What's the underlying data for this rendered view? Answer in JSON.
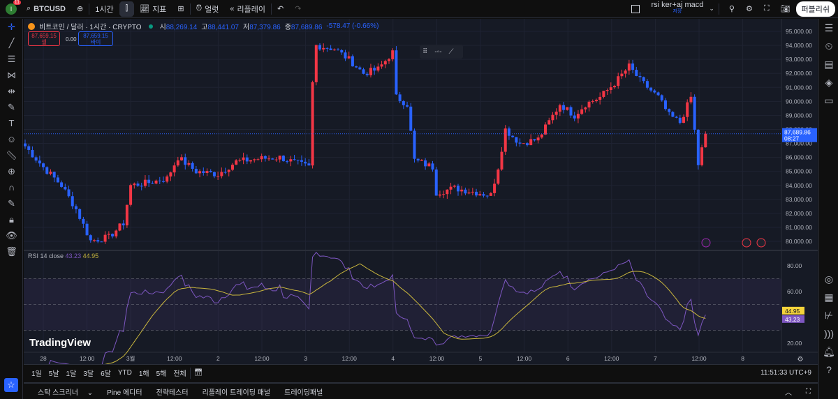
{
  "topbar": {
    "avatar_initial": "I",
    "notifications": "11",
    "symbol": "BTCUSD",
    "interval": "1시간",
    "indicators": "지표",
    "alert": "얼럿",
    "replay": "리플레이",
    "layout_name": "rsi ker+aj macd",
    "layout_status": "저장",
    "publish": "퍼블리쉬"
  },
  "legend": {
    "title": "비트코인 / 달러 · 1시간 · CRYPTO",
    "open_label": "시",
    "open": "88,269.14",
    "high_label": "고",
    "high": "88,441.07",
    "low_label": "저",
    "low": "87,379.86",
    "close_label": "종",
    "close": "87,689.86",
    "change": "-578.47 (-0.66%)",
    "sell_price": "87,659.15",
    "sell_label": "셀",
    "spread": "0.00",
    "buy_price": "87,659.15",
    "buy_label": "바이"
  },
  "colors": {
    "up": "#f23645",
    "down": "#2962ff",
    "rsi": "#7e57c2",
    "rsi_ma": "#c9b63d",
    "bg": "#161a25"
  },
  "price_axis": {
    "labels": [
      "95,000.00",
      "94,000.00",
      "93,000.00",
      "92,000.00",
      "91,000.00",
      "90,000.00",
      "89,000.00",
      "88,000.00",
      "87,000.00",
      "86,000.00",
      "85,000.00",
      "84,000.00",
      "83,000.00",
      "82,000.00",
      "81,000.00",
      "80,000.00"
    ],
    "last_price": "87,689.86",
    "countdown": "08:27"
  },
  "rsi_pane": {
    "title": "RSI 14 close",
    "rsi_value": "43.23",
    "ma_value": "44.95",
    "axis_labels": [
      "80.00",
      "60.00",
      "40.00",
      "20.00"
    ]
  },
  "time_axis": {
    "labels": [
      "28",
      "12:00",
      "3월",
      "12:00",
      "2",
      "12:00",
      "3",
      "12:00",
      "4",
      "12:00",
      "5",
      "12:00",
      "6",
      "12:00",
      "7",
      "12:00",
      "8"
    ]
  },
  "range_bar": {
    "items": [
      "1일",
      "5날",
      "1달",
      "3달",
      "6달",
      "YTD",
      "1해",
      "5해",
      "전체"
    ],
    "clock": "11:51:33 UTC+9"
  },
  "bottom_tabs": [
    "스탁 스크리너",
    "Pine 에디터",
    "전략테스터",
    "리플레이 트레이딩 패널",
    "트레이딩패널"
  ],
  "watermark": "TradingView",
  "chart_data": {
    "type": "candlestick",
    "symbol": "BTCUSD",
    "interval": "1h",
    "ylim": [
      80000,
      95000
    ],
    "price_path": [
      [
        0,
        86800
      ],
      [
        5,
        85300
      ],
      [
        10,
        84000
      ],
      [
        14,
        82300
      ],
      [
        18,
        80050
      ],
      [
        23,
        80300
      ],
      [
        27,
        81300
      ],
      [
        29,
        84000
      ],
      [
        34,
        84200
      ],
      [
        39,
        84500
      ],
      [
        42,
        86000
      ],
      [
        47,
        85000
      ],
      [
        53,
        84800
      ],
      [
        58,
        85700
      ],
      [
        64,
        85900
      ],
      [
        70,
        86000
      ],
      [
        78,
        85300
      ],
      [
        79,
        91300
      ],
      [
        80,
        94000
      ],
      [
        85,
        93750
      ],
      [
        89,
        93000
      ],
      [
        93,
        92000
      ],
      [
        97,
        92300
      ],
      [
        101,
        93500
      ],
      [
        102,
        90300
      ],
      [
        105,
        89800
      ],
      [
        107,
        85800
      ],
      [
        112,
        85300
      ],
      [
        113,
        83500
      ],
      [
        118,
        83800
      ],
      [
        124,
        83500
      ],
      [
        128,
        83300
      ],
      [
        130,
        85300
      ],
      [
        132,
        88000
      ],
      [
        136,
        87000
      ],
      [
        141,
        87300
      ],
      [
        147,
        89800
      ],
      [
        151,
        89000
      ],
      [
        154,
        89800
      ],
      [
        158,
        90300
      ],
      [
        162,
        91300
      ],
      [
        166,
        92500
      ],
      [
        169,
        91500
      ],
      [
        174,
        90300
      ],
      [
        177,
        89000
      ],
      [
        180,
        88500
      ],
      [
        183,
        90300
      ],
      [
        185,
        85500
      ],
      [
        187,
        87690
      ]
    ]
  }
}
